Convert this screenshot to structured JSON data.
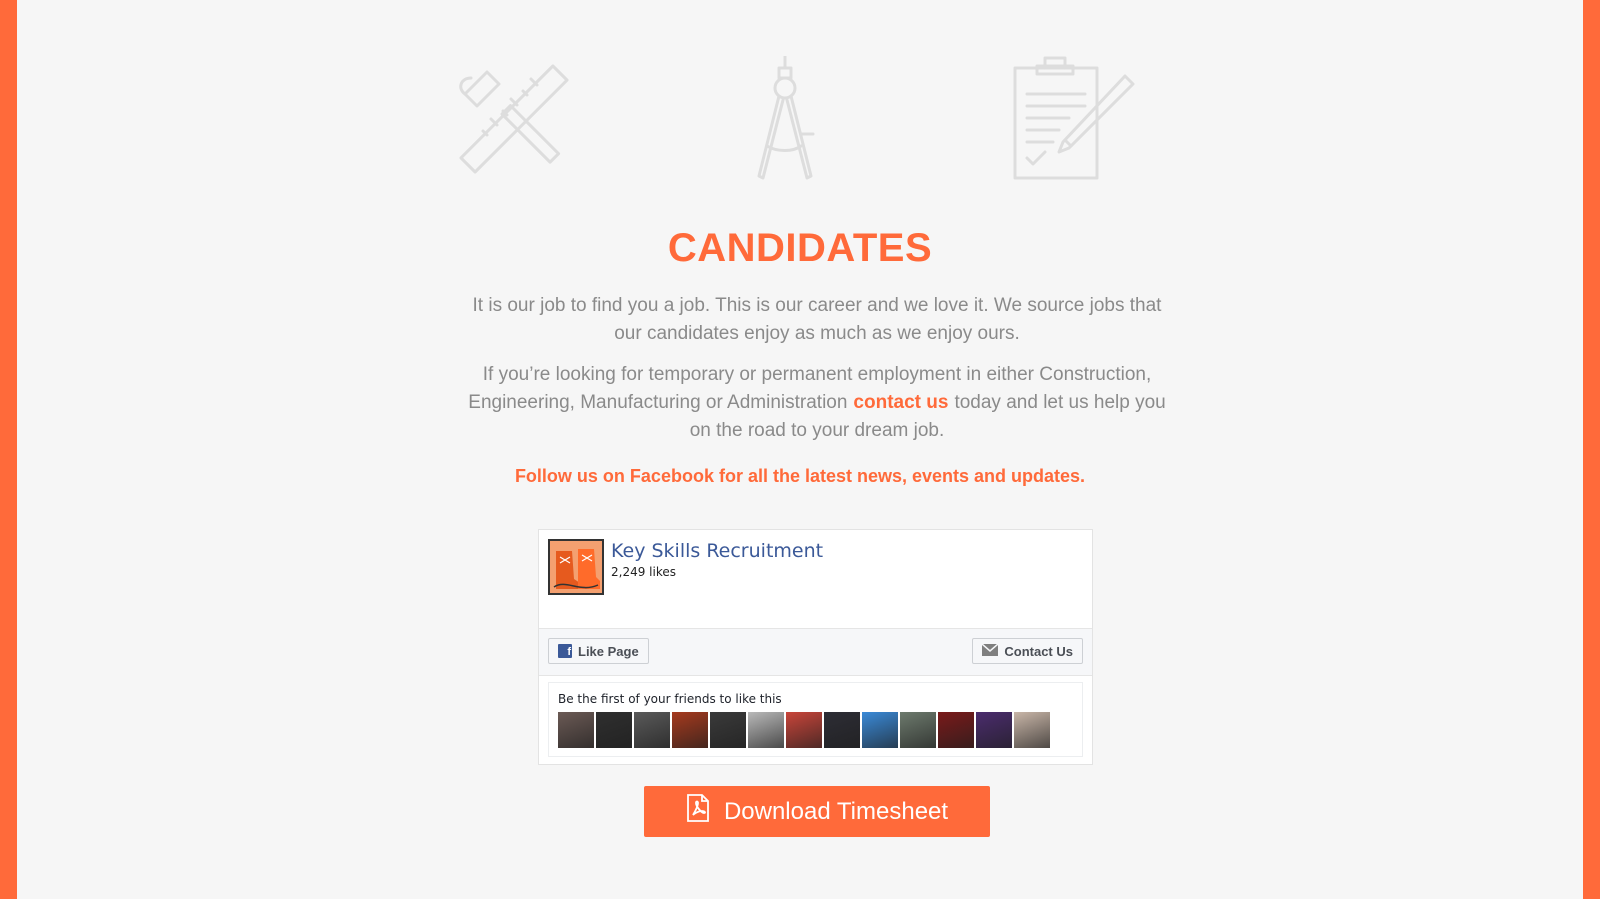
{
  "section": {
    "title": "CANDIDATES",
    "paragraph1": "It is our job to find you a job. This is our career and we love it. We source jobs that our candidates enjoy as much as we enjoy ours.",
    "paragraph2_before": "If you’re looking for temporary or permanent employment in either Construction, Engineering, Manufacturing or Administration",
    "paragraph2_link": "contact us",
    "paragraph2_after": "today and let us help you on the road to your dream job.",
    "follow": "Follow us on Facebook for all the latest news, events and updates."
  },
  "icons": [
    "hammer-ruler-icon",
    "compass-icon",
    "clipboard-pen-icon"
  ],
  "facebook": {
    "page_name": "Key Skills Recruitment",
    "likes": "2,249 likes",
    "like_button": "Like Page",
    "contact_button": "Contact Us",
    "friends_text": "Be the first of your friends to like this",
    "friend_colors": [
      "#6b5a55",
      "#2f2f2f",
      "#5a5a5a",
      "#a63a1e",
      "#3a3a3a",
      "#b9b9b9",
      "#c9453a",
      "#2d2d35",
      "#3a8ad8",
      "#6d7a6d",
      "#7a1a1a",
      "#4b2c6e",
      "#c9b6a8"
    ]
  },
  "download": {
    "label": "Download Timesheet"
  },
  "colors": {
    "accent": "#ff6a3a",
    "facebook_blue": "#3b5998"
  }
}
